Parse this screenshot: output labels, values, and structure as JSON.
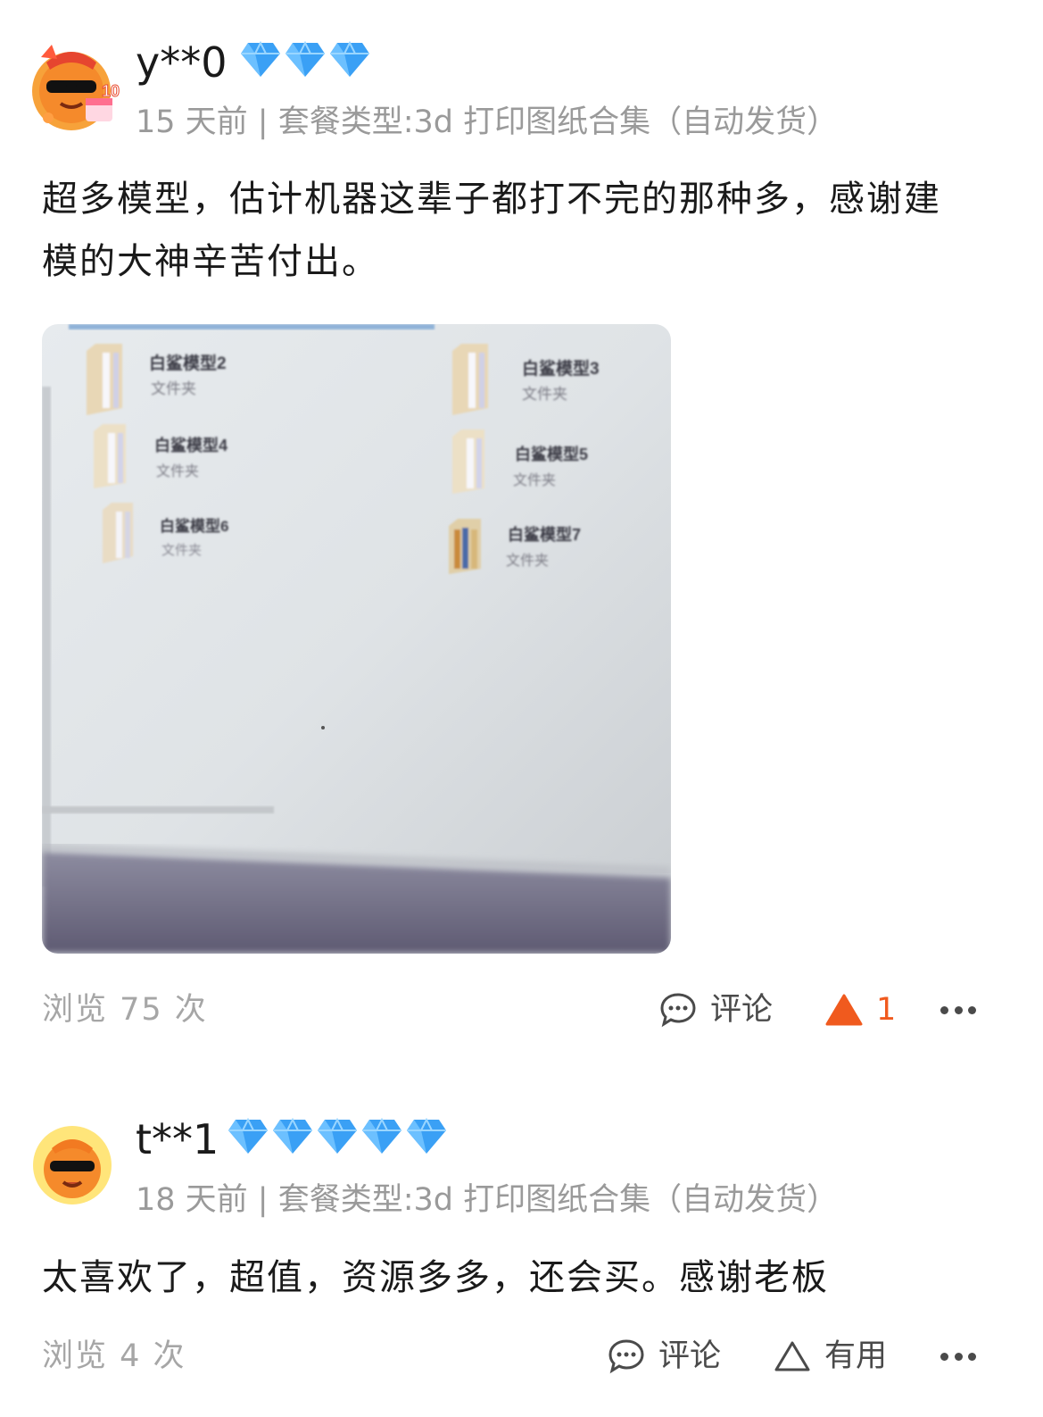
{
  "reviews": [
    {
      "username": "y**0",
      "diamond_count": 3,
      "meta": "15 天前 | 套餐类型:3d 打印图纸合集（自动发货）",
      "text_line1": "超多模型，估计机器这辈子都打不完的那种多，感谢建",
      "text_line2": "模的大神辛苦付出。",
      "photo": {
        "folders": [
          {
            "name": "白鲨模型2",
            "type": "文件夹"
          },
          {
            "name": "白鲨模型3",
            "type": "文件夹"
          },
          {
            "name": "白鲨模型4",
            "type": "文件夹"
          },
          {
            "name": "白鲨模型5",
            "type": "文件夹"
          },
          {
            "name": "白鲨模型6",
            "type": "文件夹"
          },
          {
            "name": "白鲨模型7",
            "type": "文件夹"
          }
        ]
      },
      "views": "浏览 75 次",
      "comment_label": "评论",
      "useful_count": "1",
      "accent_color": "#f05a1e"
    },
    {
      "username": "t**1",
      "diamond_count": 5,
      "meta": "18 天前 | 套餐类型:3d 打印图纸合集（自动发货）",
      "text_line1": "太喜欢了，超值，资源多多，还会买。感谢老板",
      "views": "浏览 4 次",
      "comment_label": "评论",
      "useful_label": "有用"
    }
  ],
  "icons": {
    "diamond": "diamond-icon",
    "comment": "comment-bubble-icon",
    "useful_active": "triangle-filled-icon",
    "useful": "triangle-outline-icon",
    "more": "more-dots-icon"
  },
  "colors": {
    "diamond": "#3aa0f5",
    "meta_gray": "#9a9a9a",
    "accent": "#f05a1e"
  }
}
